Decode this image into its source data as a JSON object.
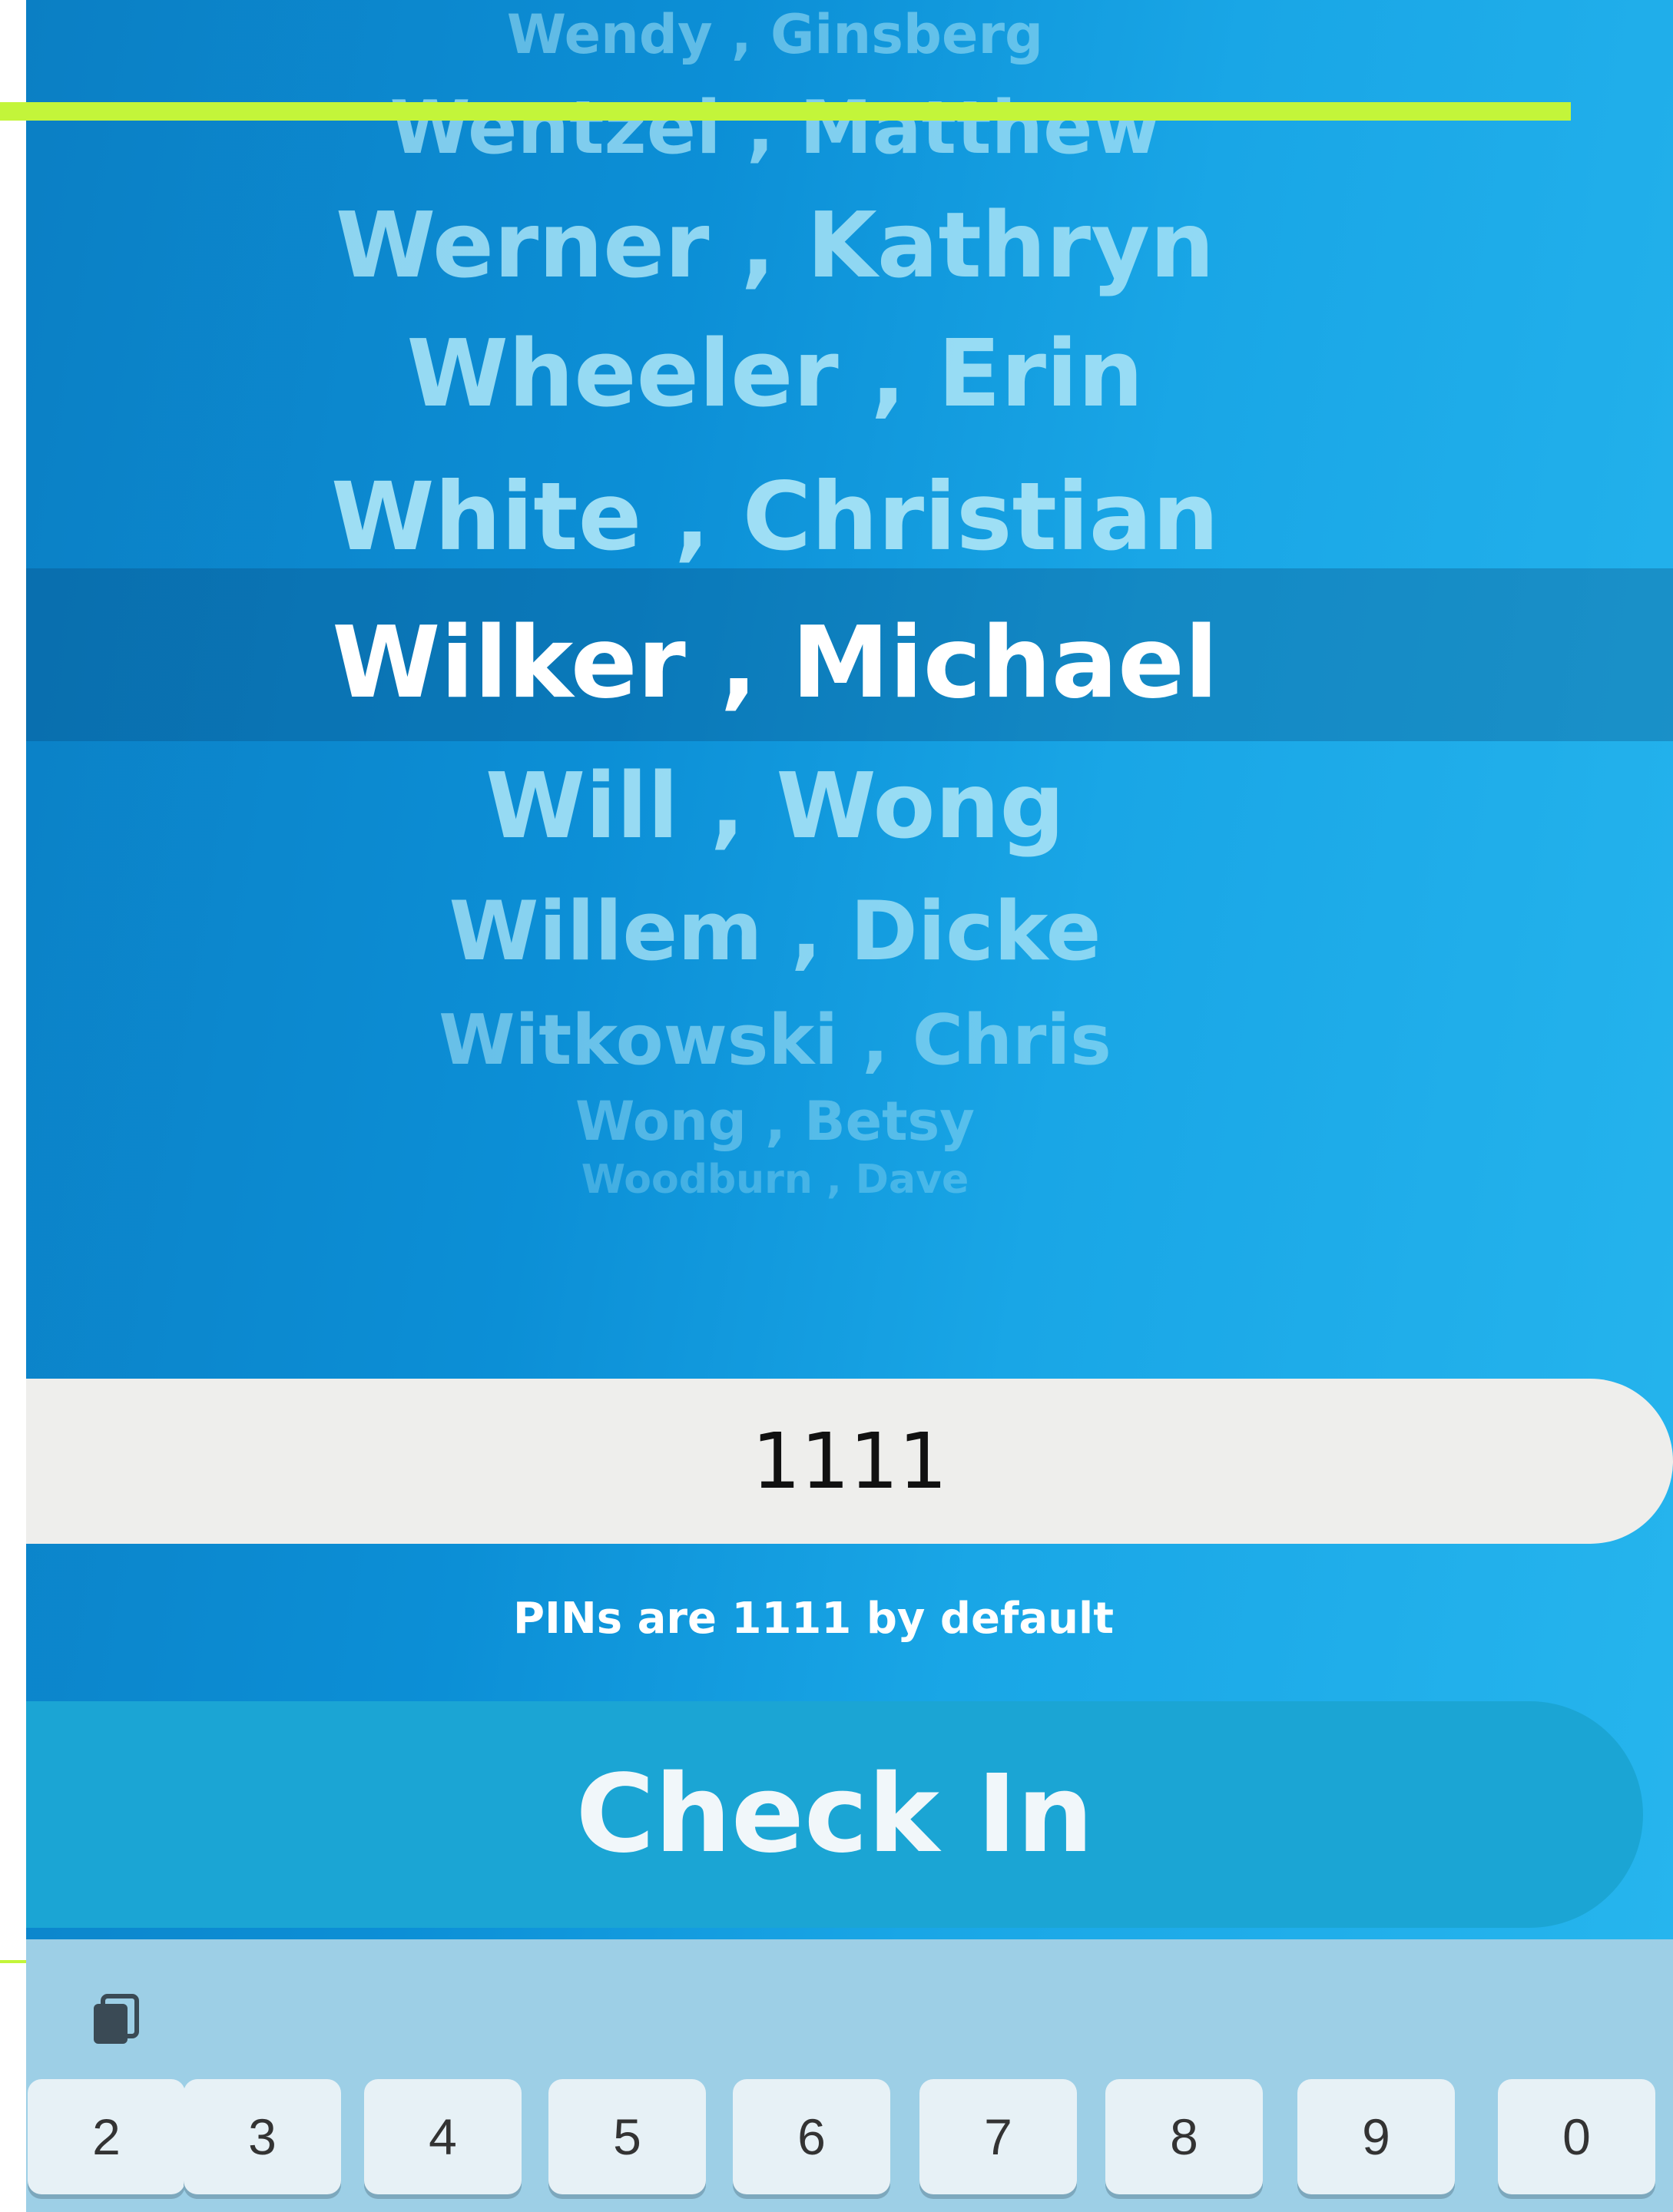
{
  "picker": {
    "items": [
      "Wendy , Ginsberg",
      "Wentzel , Matthew",
      "Werner , Kathryn",
      "Wheeler , Erin",
      "White , Christian",
      "Wilker , Michael",
      "Will , Wong",
      "Willem , Dicke",
      "Witkowski , Chris",
      "Wong , Betsy",
      "Woodburn , Dave"
    ],
    "selected_index": 5
  },
  "pin_field": {
    "value": "1111"
  },
  "pin_hint": "PINs are 1111 by default",
  "check_in_label": "Check In",
  "keyboard": {
    "paste_icon": "paste-icon",
    "keys": [
      "2",
      "3",
      "4",
      "5",
      "6",
      "7",
      "8",
      "9",
      "0"
    ]
  },
  "colors": {
    "background_blue": "#0c8fd6",
    "accent_green": "#c3f53a",
    "button": "#1ba5d4",
    "field": "#eeeeec",
    "keyboard": "#9dcfe6"
  }
}
